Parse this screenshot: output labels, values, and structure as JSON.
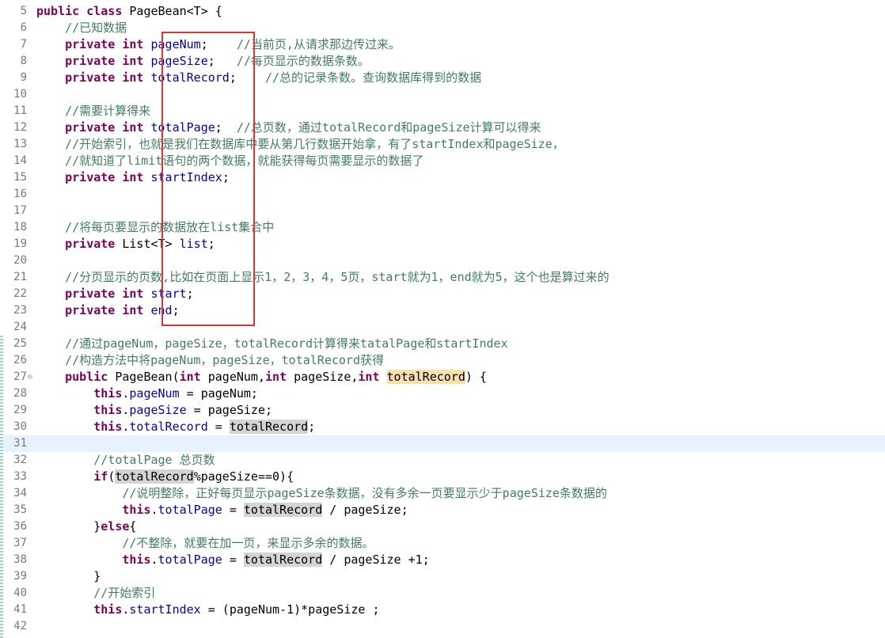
{
  "editor": {
    "current_line": 31,
    "lines": [
      {
        "n": "5",
        "segs": [
          {
            "t": "public class",
            "c": "kw"
          },
          {
            "t": " PageBean<T> {"
          }
        ]
      },
      {
        "n": "6",
        "segs": [
          {
            "t": "    "
          },
          {
            "t": "//已知数据",
            "c": "cm"
          }
        ]
      },
      {
        "n": "7",
        "segs": [
          {
            "t": "    "
          },
          {
            "t": "private int",
            "c": "kw"
          },
          {
            "t": " "
          },
          {
            "t": "pageNum",
            "c": "fd"
          },
          {
            "t": ";    "
          },
          {
            "t": "//当前页,从请求那边传过来。",
            "c": "cm"
          }
        ]
      },
      {
        "n": "8",
        "segs": [
          {
            "t": "    "
          },
          {
            "t": "private int",
            "c": "kw"
          },
          {
            "t": " "
          },
          {
            "t": "pageSize",
            "c": "fd"
          },
          {
            "t": ";   "
          },
          {
            "t": "//每页显示的数据条数。",
            "c": "cm"
          }
        ]
      },
      {
        "n": "9",
        "segs": [
          {
            "t": "    "
          },
          {
            "t": "private int",
            "c": "kw"
          },
          {
            "t": " "
          },
          {
            "t": "totalRecord",
            "c": "fd"
          },
          {
            "t": ";    "
          },
          {
            "t": "//总的记录条数。查询数据库得到的数据",
            "c": "cm"
          }
        ]
      },
      {
        "n": "10",
        "segs": []
      },
      {
        "n": "11",
        "segs": [
          {
            "t": "    "
          },
          {
            "t": "//需要计算得来",
            "c": "cm"
          }
        ]
      },
      {
        "n": "12",
        "segs": [
          {
            "t": "    "
          },
          {
            "t": "private int",
            "c": "kw"
          },
          {
            "t": " "
          },
          {
            "t": "totalPage",
            "c": "fd"
          },
          {
            "t": ";  "
          },
          {
            "t": "//总页数，通过totalRecord和pageSize计算可以得来",
            "c": "cm"
          }
        ]
      },
      {
        "n": "13",
        "segs": [
          {
            "t": "    "
          },
          {
            "t": "//开始索引，也就是我们在数据库中要从第几行数据开始拿，有了startIndex和pageSize，",
            "c": "cm"
          }
        ]
      },
      {
        "n": "14",
        "segs": [
          {
            "t": "    "
          },
          {
            "t": "//就知道了limit语句的两个数据，就能获得每页需要显示的数据了",
            "c": "cm"
          }
        ]
      },
      {
        "n": "15",
        "segs": [
          {
            "t": "    "
          },
          {
            "t": "private int",
            "c": "kw"
          },
          {
            "t": " "
          },
          {
            "t": "startIndex",
            "c": "fd"
          },
          {
            "t": ";"
          }
        ]
      },
      {
        "n": "16",
        "segs": []
      },
      {
        "n": "17",
        "segs": []
      },
      {
        "n": "18",
        "segs": [
          {
            "t": "    "
          },
          {
            "t": "//将每页要显示的数据放在list集合中",
            "c": "cm"
          }
        ]
      },
      {
        "n": "19",
        "segs": [
          {
            "t": "    "
          },
          {
            "t": "private",
            "c": "kw"
          },
          {
            "t": " List<T> "
          },
          {
            "t": "list",
            "c": "fd"
          },
          {
            "t": ";"
          }
        ]
      },
      {
        "n": "20",
        "segs": []
      },
      {
        "n": "21",
        "segs": [
          {
            "t": "    "
          },
          {
            "t": "//分页显示的页数,比如在页面上显示1，2，3，4，5页，start就为1，end就为5，这个也是算过来的",
            "c": "cm"
          }
        ]
      },
      {
        "n": "22",
        "segs": [
          {
            "t": "    "
          },
          {
            "t": "private int",
            "c": "kw"
          },
          {
            "t": " "
          },
          {
            "t": "start",
            "c": "fd"
          },
          {
            "t": ";"
          }
        ]
      },
      {
        "n": "23",
        "segs": [
          {
            "t": "    "
          },
          {
            "t": "private int",
            "c": "kw"
          },
          {
            "t": " "
          },
          {
            "t": "end",
            "c": "fd"
          },
          {
            "t": ";"
          }
        ]
      },
      {
        "n": "24",
        "segs": []
      },
      {
        "n": "25",
        "segs": [
          {
            "t": "    "
          },
          {
            "t": "//通过pageNum，pageSize，totalRecord计算得来tatalPage和startIndex",
            "c": "cm"
          }
        ]
      },
      {
        "n": "26",
        "segs": [
          {
            "t": "    "
          },
          {
            "t": "//构造方法中将pageNum，pageSize，totalRecord获得",
            "c": "cm"
          }
        ]
      },
      {
        "n": "27",
        "fold": "⊖",
        "segs": [
          {
            "t": "    "
          },
          {
            "t": "public",
            "c": "kw"
          },
          {
            "t": " PageBean("
          },
          {
            "t": "int",
            "c": "kw"
          },
          {
            "t": " pageNum,"
          },
          {
            "t": "int",
            "c": "kw"
          },
          {
            "t": " pageSize,"
          },
          {
            "t": "int",
            "c": "kw"
          },
          {
            "t": " "
          },
          {
            "t": "totalRecord",
            "c": "occ-w"
          },
          {
            "t": ") {"
          }
        ]
      },
      {
        "n": "28",
        "segs": [
          {
            "t": "        "
          },
          {
            "t": "this",
            "c": "kw"
          },
          {
            "t": "."
          },
          {
            "t": "pageNum",
            "c": "fd"
          },
          {
            "t": " = pageNum;"
          }
        ]
      },
      {
        "n": "29",
        "segs": [
          {
            "t": "        "
          },
          {
            "t": "this",
            "c": "kw"
          },
          {
            "t": "."
          },
          {
            "t": "pageSize",
            "c": "fd"
          },
          {
            "t": " = pageSize;"
          }
        ]
      },
      {
        "n": "30",
        "segs": [
          {
            "t": "        "
          },
          {
            "t": "this",
            "c": "kw"
          },
          {
            "t": "."
          },
          {
            "t": "totalRecord",
            "c": "fd"
          },
          {
            "t": " = "
          },
          {
            "t": "totalRecord",
            "c": "occ-r"
          },
          {
            "t": ";"
          }
        ]
      },
      {
        "n": "31",
        "segs": []
      },
      {
        "n": "32",
        "segs": [
          {
            "t": "        "
          },
          {
            "t": "//totalPage 总页数",
            "c": "cm"
          }
        ]
      },
      {
        "n": "33",
        "segs": [
          {
            "t": "        "
          },
          {
            "t": "if",
            "c": "kw"
          },
          {
            "t": "("
          },
          {
            "t": "totalRecord",
            "c": "occ-r"
          },
          {
            "t": "%pageSize==0){"
          }
        ]
      },
      {
        "n": "34",
        "segs": [
          {
            "t": "            "
          },
          {
            "t": "//说明整除，正好每页显示pageSize条数据，没有多余一页要显示少于pageSize条数据的",
            "c": "cm"
          }
        ]
      },
      {
        "n": "35",
        "segs": [
          {
            "t": "            "
          },
          {
            "t": "this",
            "c": "kw"
          },
          {
            "t": "."
          },
          {
            "t": "totalPage",
            "c": "fd"
          },
          {
            "t": " = "
          },
          {
            "t": "totalRecord",
            "c": "occ-r"
          },
          {
            "t": " / pageSize;"
          }
        ]
      },
      {
        "n": "36",
        "segs": [
          {
            "t": "        }"
          },
          {
            "t": "else",
            "c": "kw"
          },
          {
            "t": "{"
          }
        ]
      },
      {
        "n": "37",
        "segs": [
          {
            "t": "            "
          },
          {
            "t": "//不整除，就要在加一页，来显示多余的数据。",
            "c": "cm"
          }
        ]
      },
      {
        "n": "38",
        "segs": [
          {
            "t": "            "
          },
          {
            "t": "this",
            "c": "kw"
          },
          {
            "t": "."
          },
          {
            "t": "totalPage",
            "c": "fd"
          },
          {
            "t": " = "
          },
          {
            "t": "totalRecord",
            "c": "occ-r"
          },
          {
            "t": " / pageSize +1;"
          }
        ]
      },
      {
        "n": "39",
        "segs": [
          {
            "t": "        }"
          }
        ]
      },
      {
        "n": "40",
        "segs": [
          {
            "t": "        "
          },
          {
            "t": "//开始索引",
            "c": "cm"
          }
        ]
      },
      {
        "n": "41",
        "segs": [
          {
            "t": "        "
          },
          {
            "t": "this",
            "c": "kw"
          },
          {
            "t": "."
          },
          {
            "t": "startIndex",
            "c": "fd"
          },
          {
            "t": " = (pageNum-1)*pageSize ;"
          }
        ]
      },
      {
        "n": "42",
        "segs": []
      }
    ]
  },
  "colors": {
    "keyword": "#7f0055",
    "comment": "#3f7f5f",
    "field": "#0000c0",
    "highlight_box": "#e53333",
    "current_line": "#e8f2fe"
  }
}
